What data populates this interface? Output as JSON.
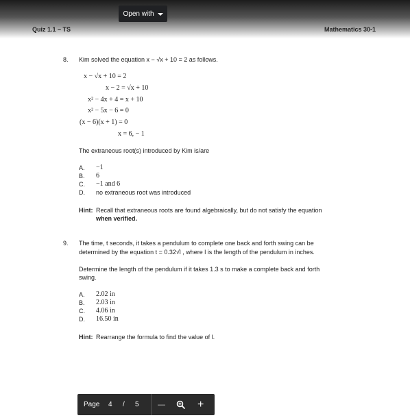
{
  "toolbar_top": {
    "open_with_label": "Open with"
  },
  "header": {
    "left": "Quiz 1.1 – TS",
    "right": "Mathematics 30-1"
  },
  "q8": {
    "number": "8.",
    "prompt": "Kim solved the equation x − √x + 10 = 2 as follows.",
    "steps": [
      "x − √x + 10 = 2",
      "x − 2 = √x + 10",
      "x² − 4x + 4 = x + 10",
      "x² − 5x − 6 = 0",
      "(x − 6)(x + 1) = 0",
      "x = 6, − 1"
    ],
    "question": "The extraneous root(s) introduced by Kim is/are",
    "options": [
      {
        "letter": "A.",
        "text": "−1"
      },
      {
        "letter": "B.",
        "text": "6"
      },
      {
        "letter": "C.",
        "text": "−1 and 6"
      },
      {
        "letter": "D.",
        "text": "no extraneous root was introduced"
      }
    ],
    "hint_label": "Hint:",
    "hint_line1": "Recall that extraneous roots are found algebraically, but do not satisfy the equation",
    "hint_line2": "when verified."
  },
  "q9": {
    "number": "9.",
    "line1": "The time, t seconds, it takes a pendulum to complete one back and forth swing can be",
    "line2": "determined by the equation t = 0.32√l , where l is the length of the pendulum in inches.",
    "line3": "Determine the length of the pendulum if it takes 1.3 s to make a complete back and forth",
    "line4": "swing.",
    "options": [
      {
        "letter": "A.",
        "text": "2.02 in"
      },
      {
        "letter": "B.",
        "text": "2.03 in"
      },
      {
        "letter": "C.",
        "text": "4.06 in"
      },
      {
        "letter": "D.",
        "text": "16.50 in"
      }
    ],
    "hint_label": "Hint:",
    "hint_text": "Rearrange the formula to find the value of l."
  },
  "pager": {
    "page_label": "Page",
    "current": "4",
    "divider": "/",
    "total": "5",
    "zoom_out": "—",
    "zoom_in": "+"
  }
}
